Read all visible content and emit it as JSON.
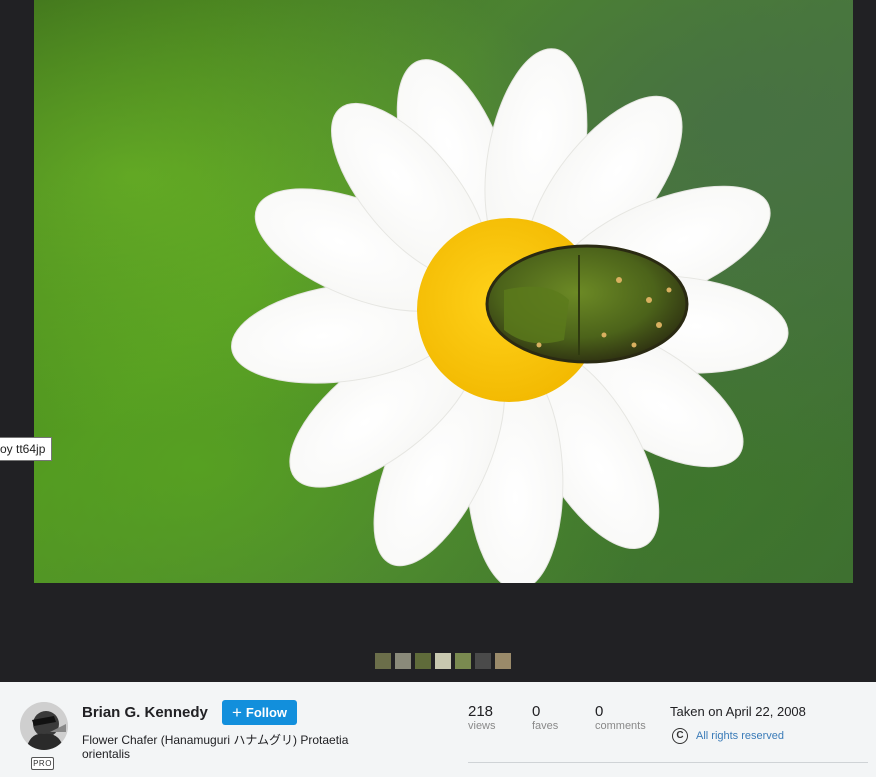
{
  "tooltip": {
    "text": "oy tt64jp"
  },
  "photo": {
    "alt_subject": ""
  },
  "filmstrip": {
    "thumbs": [
      {
        "color": "#6b6e4a"
      },
      {
        "color": "#8a8a7a"
      },
      {
        "color": "#5f6b3a"
      },
      {
        "color": "#c9c9b0"
      },
      {
        "color": "#7a8a50"
      },
      {
        "color": "#4a4a4a"
      },
      {
        "color": "#9a8a6a"
      }
    ]
  },
  "owner": {
    "name": "Brian G. Kennedy",
    "badge": "PRO",
    "follow_label": "Follow"
  },
  "photo_info": {
    "title": "Flower Chafer (Hanamuguri ハナムグリ) Protaetia orientalis"
  },
  "stats": {
    "views": {
      "value": "218",
      "label": "views"
    },
    "faves": {
      "value": "0",
      "label": "faves"
    },
    "comments": {
      "value": "0",
      "label": "comments"
    }
  },
  "meta": {
    "taken": "Taken on April 22, 2008",
    "license_icon": "copyright-icon",
    "license": "All rights reserved"
  },
  "colors": {
    "accent": "#128fdc",
    "background": "#212124",
    "info_bg": "#f3f5f6",
    "link": "#3a7bb8"
  }
}
